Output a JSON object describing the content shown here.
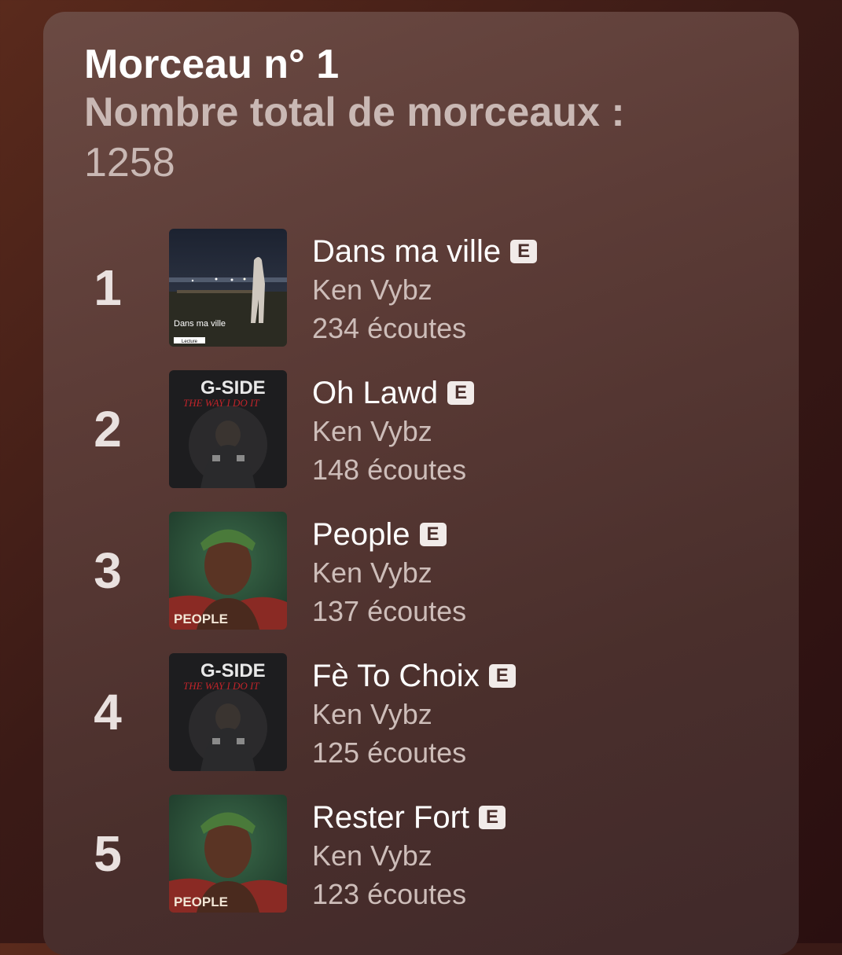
{
  "header": {
    "title": "Morceau n° 1",
    "subtitle": "Nombre total de morceaux :",
    "total": "1258"
  },
  "tracks": [
    {
      "rank": "1",
      "title": "Dans ma ville",
      "explicit": "E",
      "artist": "Ken Vybz",
      "plays": "234 écoutes",
      "cover": {
        "icon": "album-cover-night-city",
        "text": "Dans ma ville",
        "button": "Lecture"
      }
    },
    {
      "rank": "2",
      "title": "Oh Lawd",
      "explicit": "E",
      "artist": "Ken Vybz",
      "plays": "148 écoutes",
      "cover": {
        "icon": "album-cover-gside",
        "text": "G-SIDE",
        "subtext": "THE WAY I DO IT"
      }
    },
    {
      "rank": "3",
      "title": "People",
      "explicit": "E",
      "artist": "Ken Vybz",
      "plays": "137 écoutes",
      "cover": {
        "icon": "album-cover-people",
        "text": "PEOPLE"
      }
    },
    {
      "rank": "4",
      "title": "Fè To Choix",
      "explicit": "E",
      "artist": "Ken Vybz",
      "plays": "125 écoutes",
      "cover": {
        "icon": "album-cover-gside",
        "text": "G-SIDE",
        "subtext": "THE WAY I DO IT"
      }
    },
    {
      "rank": "5",
      "title": "Rester Fort",
      "explicit": "E",
      "artist": "Ken Vybz",
      "plays": "123 écoutes",
      "cover": {
        "icon": "album-cover-people",
        "text": "PEOPLE"
      }
    }
  ],
  "colors": {
    "accent": "#ffffff",
    "secondary_text": "#cdbdb9",
    "card": "#5b3b36"
  }
}
